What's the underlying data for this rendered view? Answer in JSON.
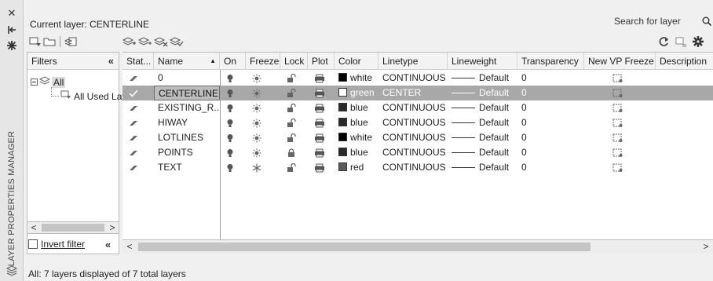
{
  "palette": {
    "title": "LAYER PROPERTIES MANAGER",
    "controls": [
      {
        "name": "close",
        "glyph": "✕"
      },
      {
        "name": "autohide",
        "glyph": "⊣"
      },
      {
        "name": "properties",
        "glyph": "✱"
      }
    ]
  },
  "header": {
    "current_layer": "Current layer: CENTERLINE",
    "search_placeholder": "Search for layer"
  },
  "filters": {
    "header": "Filters",
    "collapse_glyph": "«",
    "tree": {
      "root": "All",
      "child": "All Used Layers"
    },
    "invert_filter_label": "Invert filter",
    "invert_checked": false
  },
  "columns": [
    {
      "key": "status",
      "label": "Stat..."
    },
    {
      "key": "name",
      "label": "Name"
    },
    {
      "key": "on",
      "label": "On"
    },
    {
      "key": "freeze",
      "label": "Freeze"
    },
    {
      "key": "lock",
      "label": "Lock"
    },
    {
      "key": "plot",
      "label": "Plot"
    },
    {
      "key": "color",
      "label": "Color"
    },
    {
      "key": "linetype",
      "label": "Linetype"
    },
    {
      "key": "lineweight",
      "label": "Lineweight"
    },
    {
      "key": "transparency",
      "label": "Transparency"
    },
    {
      "key": "newvp",
      "label": "New VP Freeze"
    },
    {
      "key": "description",
      "label": "Description"
    }
  ],
  "layers": [
    {
      "name": "0",
      "current": false,
      "on": true,
      "frozen": false,
      "locked": false,
      "color_name": "white",
      "color_hex": "#000000",
      "linetype": "CONTINUOUS",
      "lineweight": "Default",
      "transparency": "0",
      "selected": false
    },
    {
      "name": "CENTERLINE",
      "current": true,
      "on": true,
      "frozen": false,
      "locked": false,
      "color_name": "green",
      "color_hex": "#ffffff",
      "linetype": "CENTER",
      "lineweight": "Default",
      "transparency": "0",
      "selected": true
    },
    {
      "name": "EXISTING_R...",
      "current": false,
      "on": true,
      "frozen": false,
      "locked": false,
      "color_name": "blue",
      "color_hex": "#2a2a2a",
      "linetype": "CONTINUOUS",
      "lineweight": "Default",
      "transparency": "0",
      "selected": false
    },
    {
      "name": "HIWAY",
      "current": false,
      "on": true,
      "frozen": false,
      "locked": false,
      "color_name": "blue",
      "color_hex": "#2a2a2a",
      "linetype": "CONTINUOUS",
      "lineweight": "Default",
      "transparency": "0",
      "selected": false
    },
    {
      "name": "LOTLINES",
      "current": false,
      "on": true,
      "frozen": false,
      "locked": false,
      "color_name": "white",
      "color_hex": "#000000",
      "linetype": "CONTINUOUS",
      "lineweight": "Default",
      "transparency": "0",
      "selected": false
    },
    {
      "name": "POINTS",
      "current": false,
      "on": true,
      "frozen": false,
      "locked": true,
      "color_name": "blue",
      "color_hex": "#2a2a2a",
      "linetype": "CONTINUOUS",
      "lineweight": "Default",
      "transparency": "0",
      "selected": false
    },
    {
      "name": "TEXT",
      "current": false,
      "on": true,
      "frozen": true,
      "locked": false,
      "color_name": "red",
      "color_hex": "#5a5a5a",
      "linetype": "CONTINUOUS",
      "lineweight": "Default",
      "transparency": "0",
      "selected": false
    }
  ],
  "status_bar": "All: 7 layers displayed of 7 total layers",
  "colors": {
    "selected_row": "#a8a8a8",
    "panel_bg": "#f0f0f0"
  }
}
